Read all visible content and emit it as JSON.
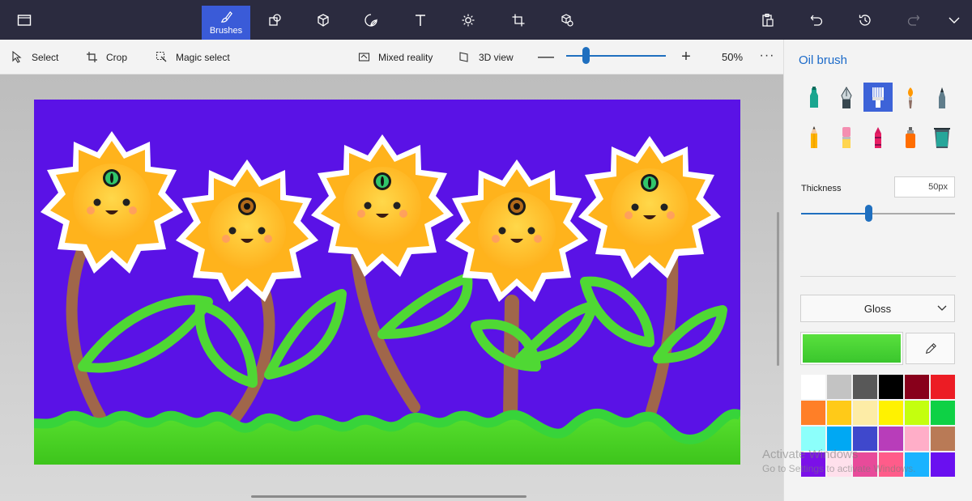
{
  "topbar": {
    "brushes_label": "Brushes",
    "icons": [
      "menu-icon",
      "brushes-icon",
      "2d-shapes-icon",
      "3d-shapes-icon",
      "stickers-icon",
      "text-icon",
      "effects-icon",
      "canvas-icon",
      "3d-library-icon",
      "paste-icon",
      "undo-icon",
      "history-icon",
      "redo-icon",
      "close-panel-icon"
    ]
  },
  "subbar": {
    "select": "Select",
    "crop": "Crop",
    "magic_select": "Magic select",
    "mixed_reality": "Mixed reality",
    "view_3d": "3D view",
    "zoom_minus": "—",
    "zoom_plus": "+",
    "zoom_percent": "50%",
    "zoom_level": 0.2,
    "more": "···"
  },
  "panel": {
    "title": "Oil brush",
    "tools": [
      "marker",
      "calligraphy-pen",
      "oil-brush",
      "watercolor",
      "pixel-pen",
      "pencil",
      "eraser",
      "crayon",
      "spray-can",
      "fill"
    ],
    "selected_tool": "oil-brush",
    "thickness_label": "Thickness",
    "thickness_value": "50px",
    "thickness_level": 0.44,
    "finish": "Gloss",
    "current_color": "#3ac62d",
    "palette": [
      "#ffffff",
      "#c3c3c3",
      "#585858",
      "#000000",
      "#88001b",
      "#ec1c24",
      "#ff7f27",
      "#ffca18",
      "#fdeca6",
      "#fff200",
      "#c4ff0e",
      "#0ed145",
      "#8cfffb",
      "#00a8f3",
      "#3f48cc",
      "#b83dba",
      "#ffaec8",
      "#b97a56",
      "#7b10e8",
      "#ffe0ec",
      "#e84b9a",
      "#ff5c8a",
      "#1ab3ff",
      "#6a10f0"
    ]
  },
  "watermark": {
    "line1": "Activate Windows",
    "line2": "Go to Settings to activate Windows."
  },
  "colors": {
    "canvas_background": "#5a12e6",
    "accent": "#3d63d8",
    "topbar": "#2b2b3f"
  }
}
